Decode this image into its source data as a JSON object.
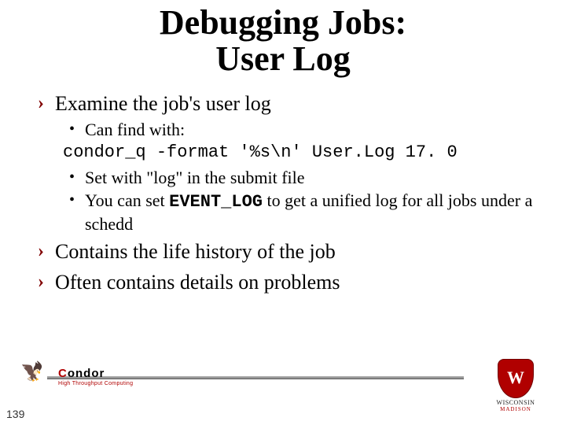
{
  "title_line1": "Debugging Jobs:",
  "title_line2": "User Log",
  "bullets": {
    "b1": "Examine the job's user log",
    "b1_sub1": "Can find with:",
    "b1_code": "condor_q -format '%s\\n' User.Log 17. 0",
    "b1_sub2_pre": "Set with \"",
    "b1_sub2_log": "log",
    "b1_sub2_post": "\" in the submit file",
    "b1_sub3_pre": "You can set ",
    "b1_sub3_code": "EVENT_LOG",
    "b1_sub3_post": " to get a unified log for all jobs under a schedd",
    "b2": "Contains the life history of the job",
    "b3": "Often contains details on problems"
  },
  "page_number": "139",
  "condor_logo": {
    "name": "Condor",
    "tagline": "High Throughput Computing"
  },
  "wisc": {
    "university": "WISCONSIN",
    "campus": "MADISON"
  }
}
